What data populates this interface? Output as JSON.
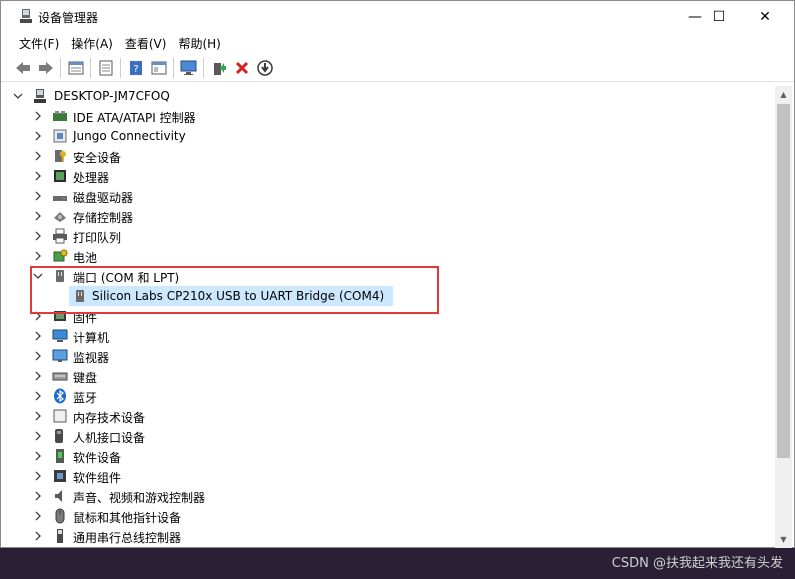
{
  "window": {
    "title": "设备管理器",
    "minimize": "—",
    "maximize": "☐",
    "close": "✕"
  },
  "menu": [
    "文件(F)",
    "操作(A)",
    "查看(V)",
    "帮助(H)"
  ],
  "toolbar": {
    "icons": [
      "back-arrow-icon",
      "forward-arrow-icon",
      "properties-icon",
      "details-icon",
      "help-icon",
      "view-icon",
      "monitor-icon",
      "update-driver-icon",
      "uninstall-icon",
      "download-icon"
    ]
  },
  "tree": {
    "root": "DESKTOP-JM7CFOQ",
    "categories": [
      {
        "label": "IDE ATA/ATAPI 控制器",
        "icon": "ide-controller-icon"
      },
      {
        "label": "Jungo Connectivity",
        "icon": "jungo-icon"
      },
      {
        "label": "安全设备",
        "icon": "security-device-icon"
      },
      {
        "label": "处理器",
        "icon": "processor-icon"
      },
      {
        "label": "磁盘驱动器",
        "icon": "disk-drive-icon"
      },
      {
        "label": "存储控制器",
        "icon": "storage-controller-icon"
      },
      {
        "label": "打印队列",
        "icon": "print-queue-icon"
      },
      {
        "label": "电池",
        "icon": "battery-icon"
      },
      {
        "label": "端口 (COM 和 LPT)",
        "icon": "port-icon",
        "expanded": true,
        "children": [
          {
            "label": "Silicon Labs CP210x USB to UART Bridge (COM4)",
            "icon": "port-device-icon",
            "selected": true
          }
        ]
      },
      {
        "label": "固件",
        "icon": "firmware-icon"
      },
      {
        "label": "计算机",
        "icon": "computer-icon"
      },
      {
        "label": "监视器",
        "icon": "monitor-icon"
      },
      {
        "label": "键盘",
        "icon": "keyboard-icon"
      },
      {
        "label": "蓝牙",
        "icon": "bluetooth-icon"
      },
      {
        "label": "内存技术设备",
        "icon": "memory-device-icon"
      },
      {
        "label": "人机接口设备",
        "icon": "hid-icon"
      },
      {
        "label": "软件设备",
        "icon": "software-device-icon"
      },
      {
        "label": "软件组件",
        "icon": "software-component-icon"
      },
      {
        "label": "声音、视频和游戏控制器",
        "icon": "sound-icon"
      },
      {
        "label": "鼠标和其他指针设备",
        "icon": "mouse-icon"
      },
      {
        "label": "通用串行总线控制器",
        "icon": "usb-controller-icon"
      }
    ]
  },
  "watermark": "CSDN @扶我起来我还有头发",
  "colors": {
    "selection": "#cce8ff",
    "highlight_border": "#e03a3a"
  }
}
